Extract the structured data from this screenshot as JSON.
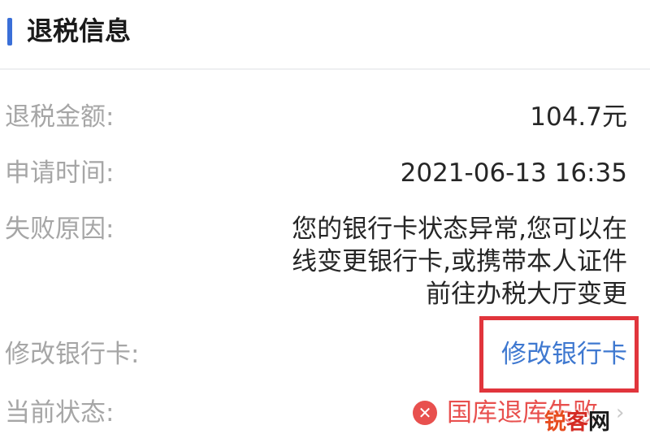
{
  "header": {
    "title": "退税信息"
  },
  "rows": {
    "refund_amount": {
      "label": "退税金额:",
      "value": "104.7元"
    },
    "apply_time": {
      "label": "申请时间:",
      "value": "2021-06-13 16:35"
    },
    "failure_reason": {
      "label": "失败原因:",
      "lines": [
        "您的银行卡状态异常,您可以在",
        "线变更银行卡,或携带本人证件",
        "前往办税大厅变更"
      ]
    },
    "modify_card": {
      "label": "修改银行卡:",
      "link": "修改银行卡"
    },
    "current_status": {
      "label": "当前状态:",
      "value": "国库退库失败",
      "icon": "error-circle-icon"
    }
  },
  "watermark": {
    "part_a": "锐",
    "part_b": "客",
    "part_c": "网"
  },
  "colors": {
    "accent": "#3a6fd8",
    "link": "#3e78d0",
    "error": "#e8504e",
    "highlight": "#e1353c",
    "label": "#a6a6a6"
  }
}
